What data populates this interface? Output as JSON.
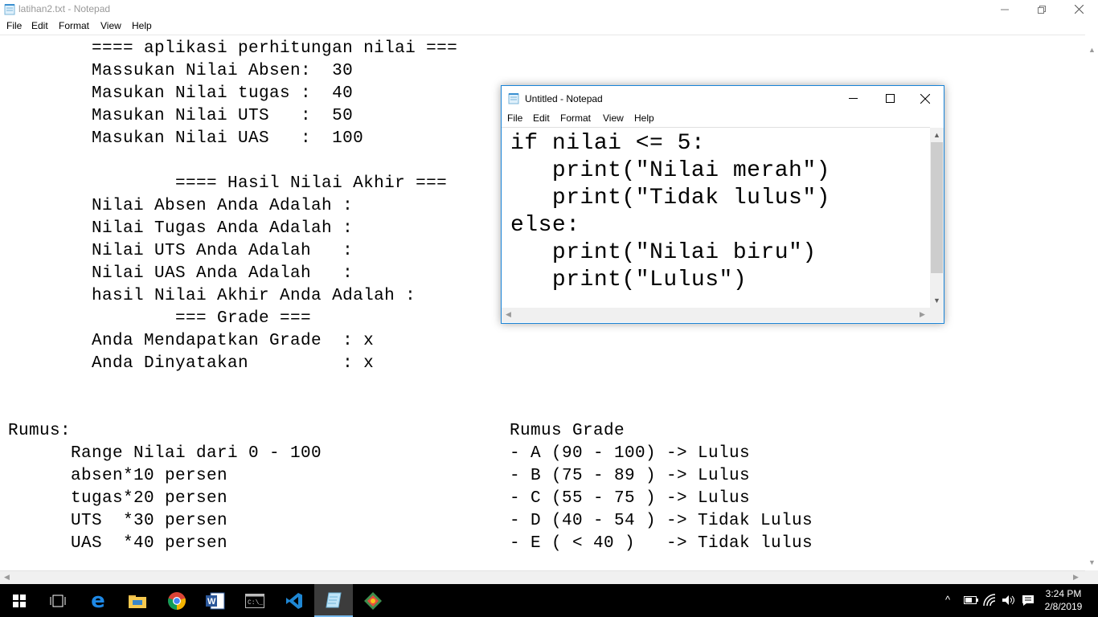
{
  "main_window": {
    "title": "latihan2.txt - Notepad",
    "menu": [
      "File",
      "Edit",
      "Format",
      "View",
      "Help"
    ],
    "lines": [
      "        ==== aplikasi perhitungan nilai ===",
      "        Massukan Nilai Absen:  30",
      "        Masukan Nilai tugas :  40",
      "        Masukan Nilai UTS   :  50",
      "        Masukan Nilai UAS   :  100",
      "",
      "                ==== Hasil Nilai Akhir ===",
      "        Nilai Absen Anda Adalah :",
      "        Nilai Tugas Anda Adalah :",
      "        Nilai UTS Anda Adalah   :",
      "        Nilai UAS Anda Adalah   :",
      "        hasil Nilai Akhir Anda Adalah :",
      "                === Grade ===",
      "        Anda Mendapatkan Grade  : x",
      "        Anda Dinyatakan         : x",
      "",
      "",
      "Rumus:",
      "      Range Nilai dari 0 - 100",
      "      absen*10 persen",
      "      tugas*20 persen",
      "      UTS  *30 persen",
      "      UAS  *40 persen"
    ],
    "grade_lines": [
      "Rumus Grade",
      "- A (90 - 100) -> Lulus",
      "- B (75 - 89 ) -> Lulus",
      "- C (55 - 75 ) -> Lulus",
      "- D (40 - 54 ) -> Tidak Lulus",
      "- E ( < 40 )   -> Tidak lulus"
    ]
  },
  "untitled_window": {
    "title": "Untitled - Notepad",
    "menu": [
      "File",
      "Edit",
      "Format",
      "View",
      "Help"
    ],
    "code_lines": [
      "if nilai <= 5:",
      "   print(\"Nilai merah\")",
      "   print(\"Tidak lulus\")",
      "else:",
      "   print(\"Nilai biru\")",
      "   print(\"Lulus\")"
    ]
  },
  "taskbar": {
    "apps": [
      "start",
      "task-view",
      "edge",
      "file-explorer",
      "chrome",
      "word",
      "cmd",
      "vscode",
      "notepad",
      "git"
    ],
    "active_app": "notepad",
    "time": "3:24 PM",
    "date": "2/8/2019"
  }
}
